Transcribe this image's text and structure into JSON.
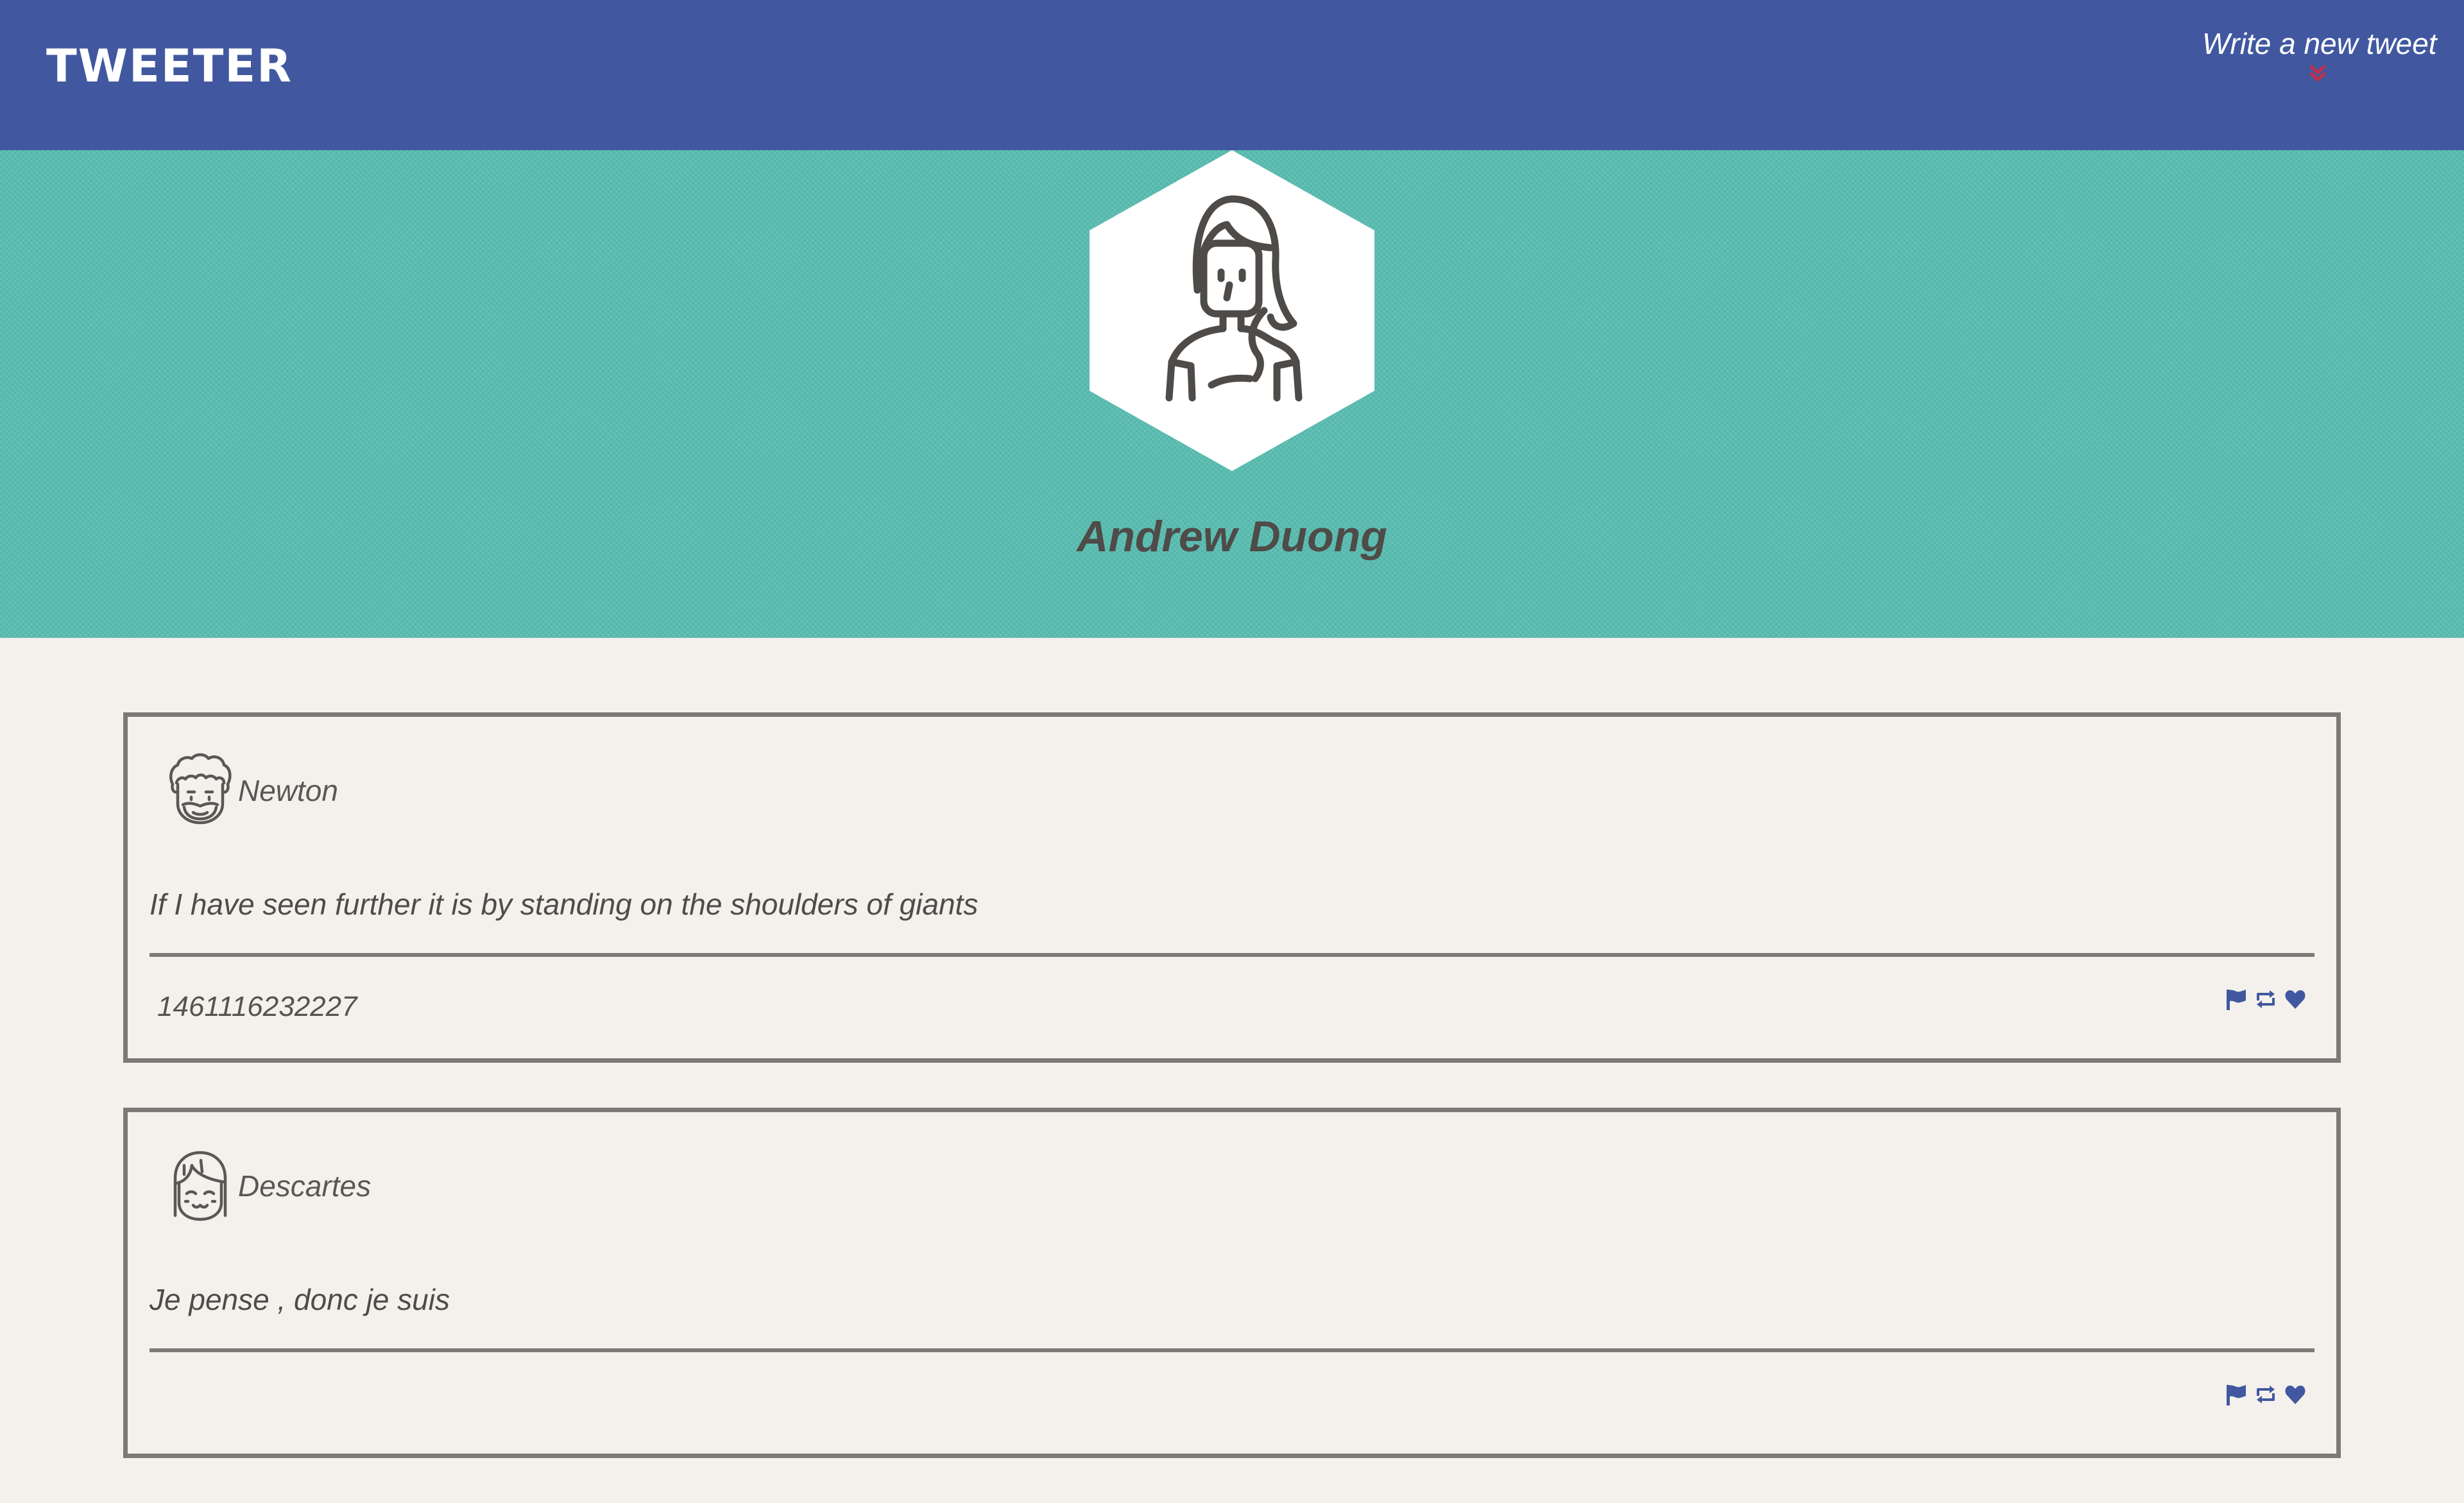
{
  "header": {
    "logo": "TWEETER",
    "compose_label": "Write a new tweet",
    "brand_color": "#4158a0",
    "chevron_color": "#c0304a",
    "chevron_icon": "double-chevron-down-icon"
  },
  "profile": {
    "name": "Andrew Duong",
    "avatar_icon": "woman-avatar-icon",
    "banner_color": "#59bdb1"
  },
  "tweets": [
    {
      "author": "Newton",
      "avatar_icon": "curly-hair-man-avatar-icon",
      "text": "If I have seen further it is by standing on the shoulders of giants",
      "timestamp": "1461116232227",
      "actions": [
        "flag-icon",
        "retweet-icon",
        "heart-icon"
      ]
    },
    {
      "author": "Descartes",
      "avatar_icon": "bangs-man-avatar-icon",
      "text": "Je pense , donc je suis",
      "timestamp": "",
      "actions": [
        "flag-icon",
        "retweet-icon",
        "heart-icon"
      ]
    }
  ]
}
